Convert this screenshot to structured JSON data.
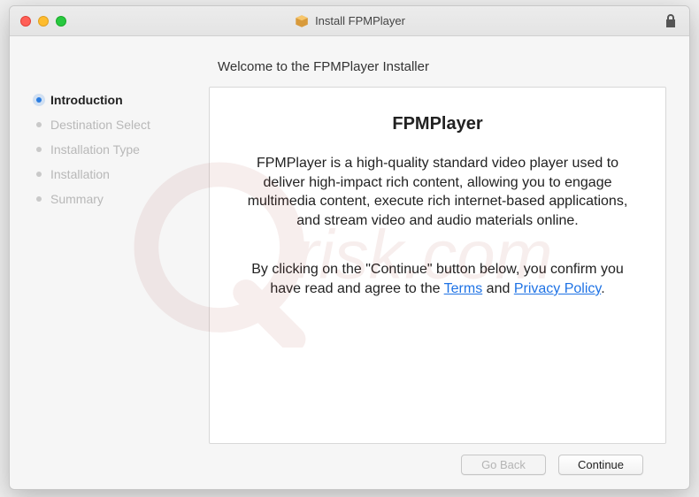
{
  "window": {
    "title": "Install FPMPlayer"
  },
  "sidebar": {
    "steps": [
      {
        "label": "Introduction",
        "active": true
      },
      {
        "label": "Destination Select",
        "active": false
      },
      {
        "label": "Installation Type",
        "active": false
      },
      {
        "label": "Installation",
        "active": false
      },
      {
        "label": "Summary",
        "active": false
      }
    ]
  },
  "main": {
    "heading": "Welcome to the FPMPlayer Installer",
    "content": {
      "title": "FPMPlayer",
      "description": "FPMPlayer is a high-quality standard video player used to deliver high-impact rich content, allowing you to engage multimedia content, execute rich internet-based applications, and stream video and audio materials online.",
      "agree_prefix": "By clicking on the \"Continue\" button below, you confirm you have read and agree to the ",
      "terms_label": "Terms",
      "agree_middle": " and ",
      "privacy_label": "Privacy Policy",
      "agree_suffix": "."
    }
  },
  "footer": {
    "go_back_label": "Go Back",
    "continue_label": "Continue"
  }
}
